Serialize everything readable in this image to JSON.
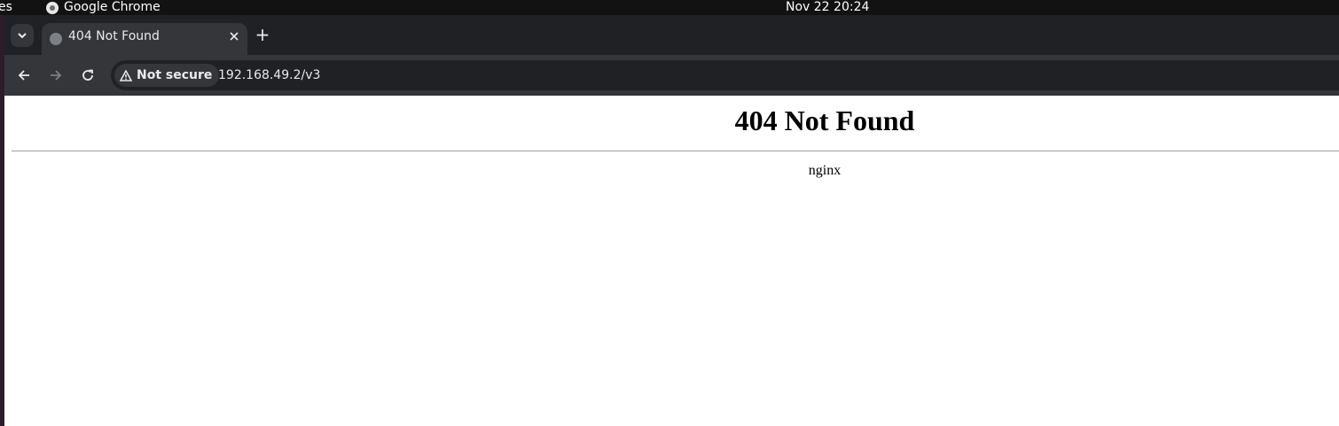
{
  "system_bar": {
    "activities_label": "es",
    "app_name": "Google Chrome",
    "clock": "Nov 22  20:24"
  },
  "browser": {
    "tab": {
      "title": "404 Not Found",
      "favicon": "globe-icon",
      "close_icon": "close-icon"
    },
    "new_tab_label": "+",
    "toolbar": {
      "security_label": "Not secure",
      "security_icon": "warning-triangle-icon",
      "url": "192.168.49.2/v3"
    }
  },
  "page": {
    "heading": "404 Not Found",
    "server": "nginx"
  },
  "colors": {
    "tabstrip": "#202124",
    "toolbar": "#35363a",
    "topbar": "#121212"
  }
}
